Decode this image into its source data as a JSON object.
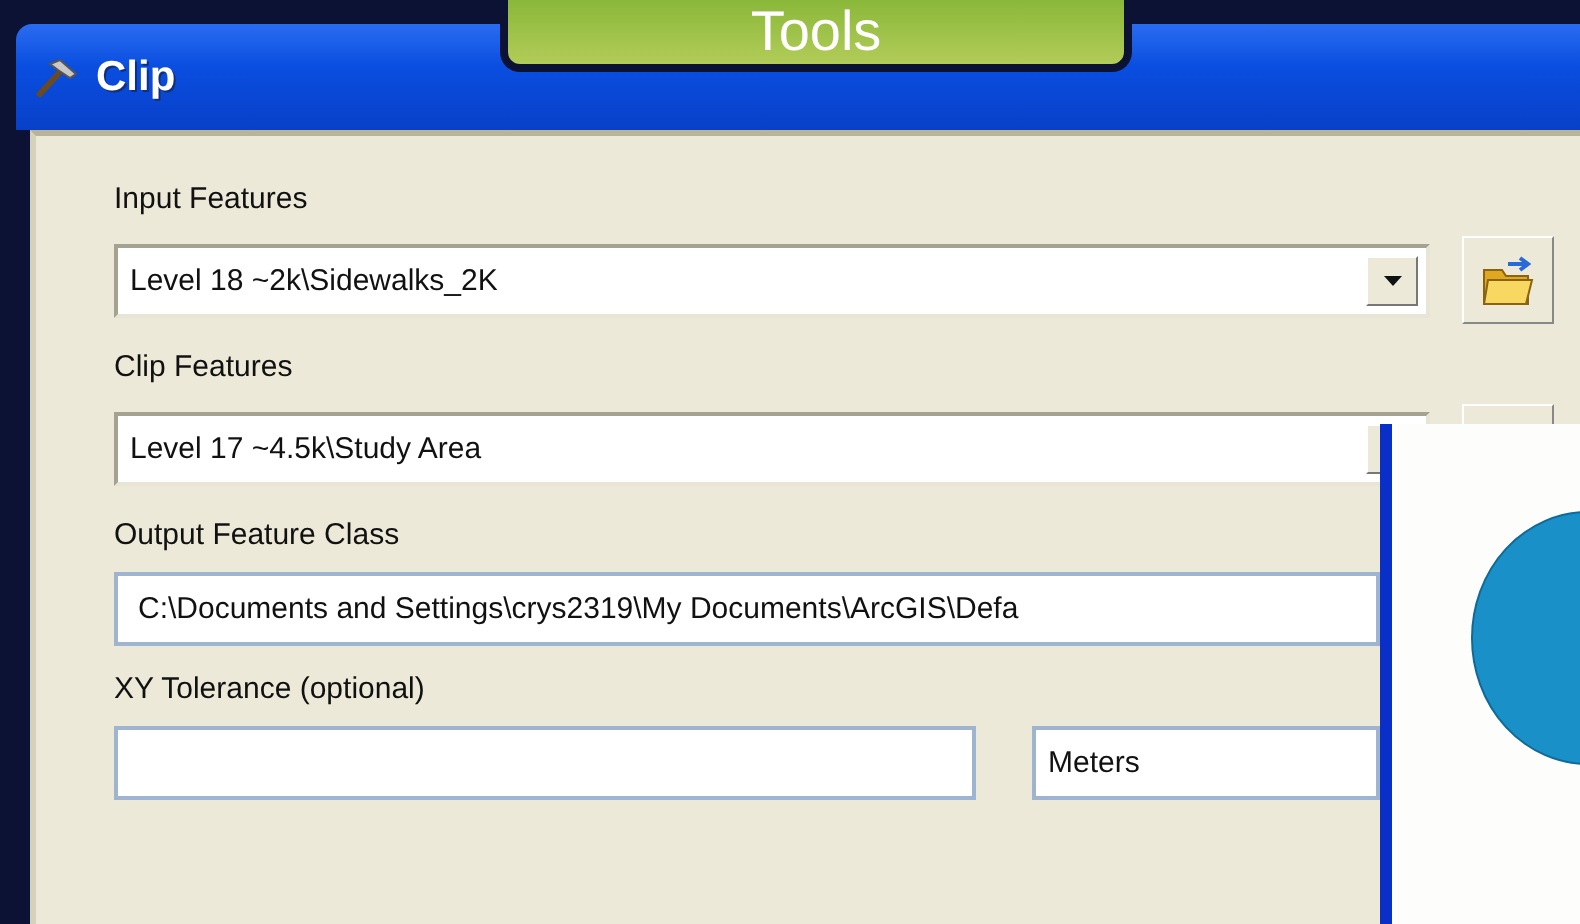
{
  "badge": {
    "text": "Tools"
  },
  "dialog": {
    "title": "Clip",
    "fields": [
      {
        "label": "Input Features",
        "value": "Level 18 ~2k\\Sidewalks_2K",
        "kind": "dropdown"
      },
      {
        "label": "Clip Features",
        "value": "Level 17 ~4.5k\\Study Area",
        "kind": "dropdown"
      },
      {
        "label": "Output Feature Class",
        "value": "C:\\Documents and Settings\\crys2319\\My Documents\\ArcGIS\\Defa",
        "kind": "path"
      }
    ],
    "tolerance": {
      "label": "XY Tolerance (optional)",
      "units": "Meters"
    }
  }
}
